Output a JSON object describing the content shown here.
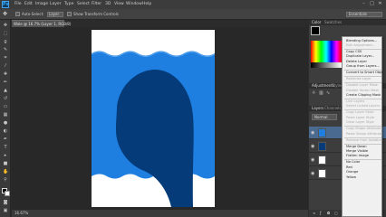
{
  "app": {
    "logo": "Ps"
  },
  "menubar": {
    "items": [
      "File",
      "Edit",
      "Image",
      "Layer",
      "Type",
      "Select",
      "Filter",
      "3D",
      "View",
      "Window",
      "Help"
    ],
    "minimize_icon": "minimize-icon",
    "restore_icon": "restore-icon",
    "close_icon": "close-icon"
  },
  "options_bar": {
    "auto_select_label": "Auto-Select:",
    "auto_select_value": "Layer",
    "show_transform_label": "Show Transform Controls",
    "workspace_value": "Essentials"
  },
  "document": {
    "tab_title": "Wale @ 16.7% (Layer 1, RGB/8)",
    "zoom": "16.67%"
  },
  "panels": {
    "color_tabs": [
      "Color",
      "Swatches"
    ],
    "adjust_tabs": [
      "Adjustments",
      "Styles"
    ],
    "layers_tabs": [
      "Layers",
      "Channels"
    ],
    "blend_mode": "Normal"
  },
  "context_menu": {
    "items": [
      {
        "label": "Blending Options...",
        "enabled": true
      },
      {
        "label": "Edit Adjustment...",
        "enabled": false
      },
      {
        "sep": true
      },
      {
        "label": "Copy CSS",
        "enabled": true
      },
      {
        "label": "Duplicate Layer...",
        "enabled": true
      },
      {
        "label": "Delete Layer",
        "enabled": true
      },
      {
        "label": "Group from Layers...",
        "enabled": true
      },
      {
        "sep": true
      },
      {
        "label": "Convert to Smart Object",
        "enabled": true
      },
      {
        "sep": true
      },
      {
        "label": "Rasterize Layer",
        "enabled": false
      },
      {
        "sep": true
      },
      {
        "label": "Disable Layer Mask",
        "enabled": false
      },
      {
        "label": "Disable Vector Mask",
        "enabled": false
      },
      {
        "label": "Create Clipping Mask",
        "enabled": true
      },
      {
        "sep": true
      },
      {
        "label": "Link Layers",
        "enabled": false
      },
      {
        "label": "Select Linked Layers",
        "enabled": false
      },
      {
        "sep": true
      },
      {
        "label": "Copy Layer Style",
        "enabled": false
      },
      {
        "label": "Paste Layer Style",
        "enabled": false
      },
      {
        "label": "Clear Layer Style",
        "enabled": false
      },
      {
        "sep": true
      },
      {
        "label": "Copy Shape Attributes",
        "enabled": false
      },
      {
        "label": "Paste Shape Attributes",
        "enabled": false
      },
      {
        "sep": true
      },
      {
        "label": "Release from Isolation",
        "enabled": false
      },
      {
        "sep": true
      },
      {
        "label": "Merge Down",
        "enabled": true
      },
      {
        "label": "Merge Visible",
        "enabled": true
      },
      {
        "label": "Flatten Image",
        "enabled": true
      },
      {
        "sep": true
      },
      {
        "label": "No Color",
        "enabled": true
      },
      {
        "label": "Red",
        "enabled": true
      },
      {
        "label": "Orange",
        "enabled": true
      },
      {
        "label": "Yellow",
        "enabled": true
      }
    ]
  },
  "colors": {
    "light_blue": "#1e7fe0",
    "dark_blue": "#053b78",
    "accent": "#3aa3f2"
  }
}
